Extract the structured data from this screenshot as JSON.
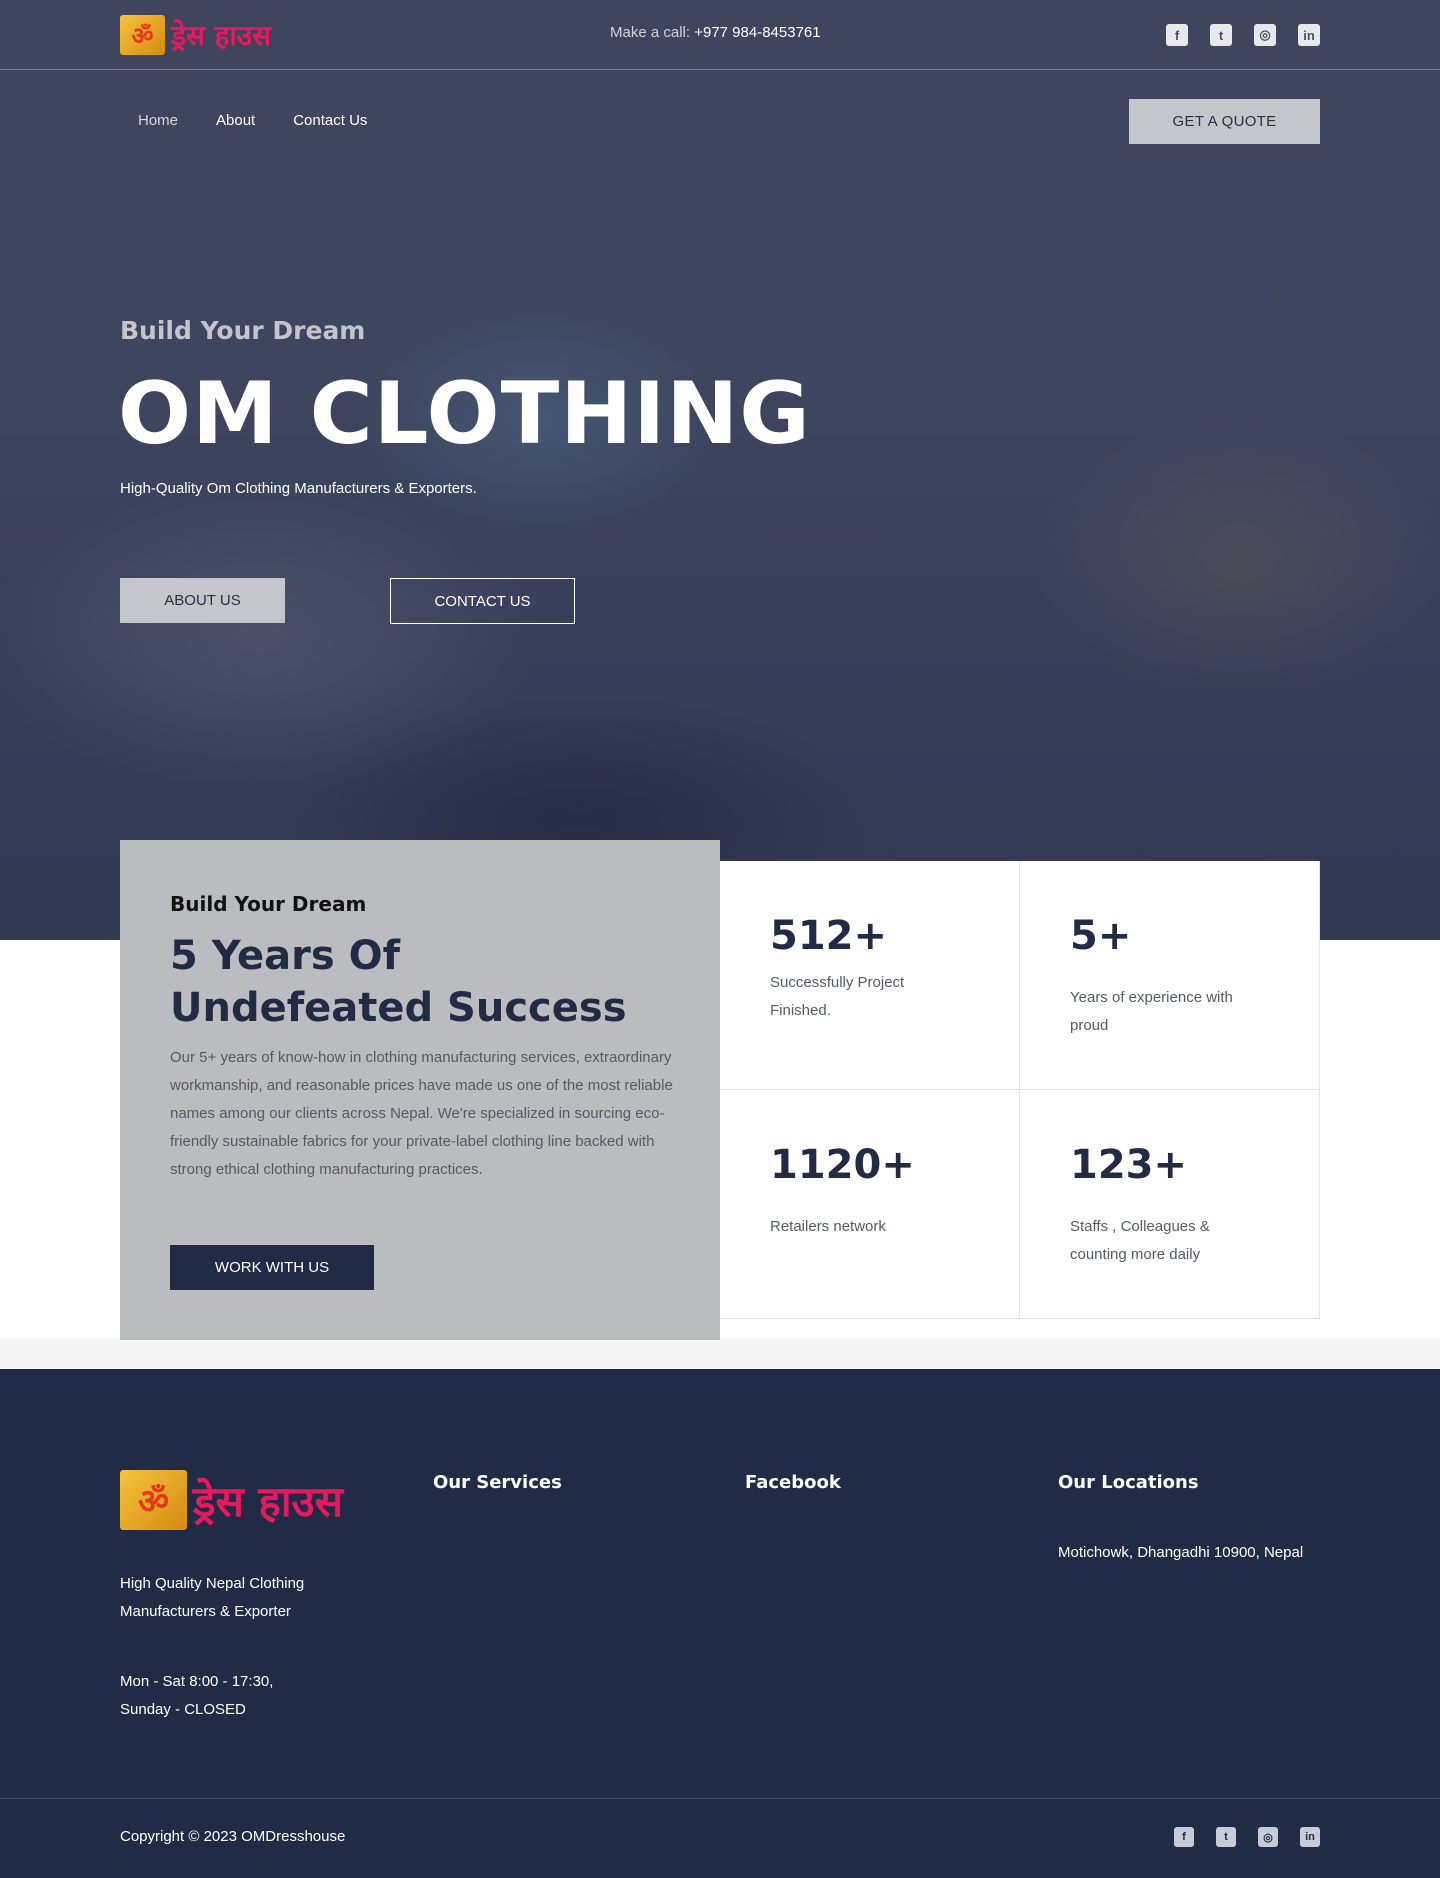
{
  "brand": {
    "logo_symbol": "ॐ",
    "logo_text": "ड्रेस हाउस"
  },
  "topbar": {
    "call_label": "Make a call:",
    "phone": "+977 984-8453761",
    "social": [
      {
        "icon": "facebook-icon",
        "glyph": "f"
      },
      {
        "icon": "twitter-icon",
        "glyph": "t"
      },
      {
        "icon": "instagram-icon",
        "glyph": "◎"
      },
      {
        "icon": "linkedin-icon",
        "glyph": "in"
      }
    ]
  },
  "nav": {
    "items": [
      {
        "label": "Home"
      },
      {
        "label": "About"
      },
      {
        "label": "Contact Us"
      }
    ],
    "quote_button": "GET A QUOTE"
  },
  "hero": {
    "subtitle": "Build Your Dream",
    "title": "OM CLOTHING",
    "description": "High-Quality Om Clothing Manufacturers & Exporters.",
    "about_button": "ABOUT US",
    "contact_button": "CONTACT US"
  },
  "success": {
    "kicker": "Build Your Dream",
    "heading": "5 Years Of Undefeated Success",
    "body": "Our 5+ years of know-how in clothing manufacturing services, extraordinary workmanship, and reasonable prices have made us one of the most reliable names among our clients across Nepal. We're specialized in sourcing eco-friendly sustainable fabrics for your private-label clothing line backed with strong ethical clothing manufacturing practices.",
    "button": "WORK WITH US"
  },
  "stats": [
    {
      "value": "512+",
      "label": "Successfully Project Finished."
    },
    {
      "value": "5+",
      "label": "Years of experience with proud"
    },
    {
      "value": "1120+",
      "label": "Retailers network"
    },
    {
      "value": "123+",
      "label": "Staffs , Colleagues & counting more daily"
    }
  ],
  "footer": {
    "tagline": "High Quality Nepal Clothing Manufacturers & Exporter",
    "hours_line1": "Mon - Sat 8:00 - 17:30,",
    "hours_line2": "Sunday - CLOSED",
    "services_title": "Our Services",
    "facebook_title": "Facebook",
    "locations_title": "Our Locations",
    "address": "Motichowk, Dhangadhi 10900, Nepal",
    "copyright": "Copyright © 2023 OMDresshouse"
  },
  "colors": {
    "navy": "#222b46",
    "brand_pink": "#e8185e",
    "logo_gold": "#f7c33c",
    "button_grey": "#c4c6cb"
  }
}
